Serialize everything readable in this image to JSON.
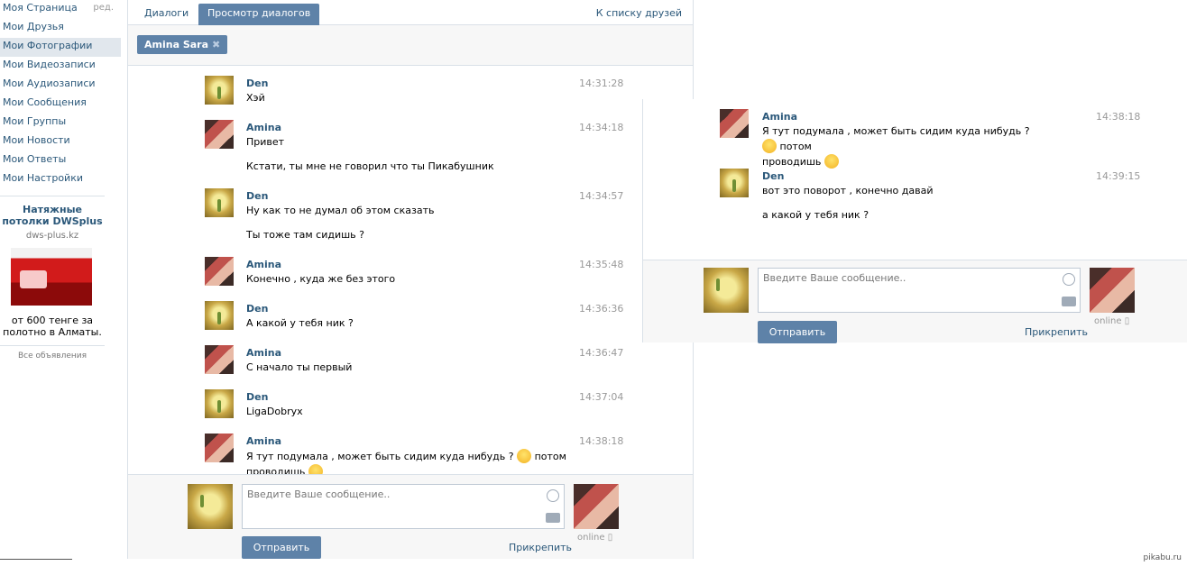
{
  "nav": {
    "items": [
      {
        "label": "Моя Страница"
      },
      {
        "label": "Мои Друзья"
      },
      {
        "label": "Мои Фотографии"
      },
      {
        "label": "Мои Видеозаписи"
      },
      {
        "label": "Мои Аудиозаписи"
      },
      {
        "label": "Мои Сообщения"
      },
      {
        "label": "Мои Группы"
      },
      {
        "label": "Мои Новости"
      },
      {
        "label": "Мои Ответы"
      },
      {
        "label": "Мои Настройки"
      }
    ],
    "edit": "ред.",
    "active_index": 2
  },
  "ad": {
    "title": "Натяжные потолки DWSplus",
    "domain": "dws-plus.kz",
    "text": "от 600 тенге за полотно в Алматы.",
    "all": "Все объявления"
  },
  "tabs": {
    "dialogs": "Диалоги",
    "view": "Просмотр диалогов",
    "to_friends": "К списку друзей"
  },
  "peer_chip": {
    "name": "Amina Sara",
    "close_icon": "close-icon"
  },
  "messages": [
    {
      "author": "Den",
      "time": "14:31:28",
      "lines": [
        "Хэй"
      ]
    },
    {
      "author": "Amina",
      "time": "14:34:18",
      "lines": [
        "Привет",
        "Кстати, ты мне не говорил что ты Пикабушник"
      ]
    },
    {
      "author": "Den",
      "time": "14:34:57",
      "lines": [
        "Ну как то не думал об этом сказать",
        "Ты тоже там сидишь ?"
      ]
    },
    {
      "author": "Amina",
      "time": "14:35:48",
      "lines": [
        "Конечно , куда же без этого"
      ]
    },
    {
      "author": "Den",
      "time": "14:36:36",
      "lines": [
        "А какой у тебя ник ?"
      ]
    },
    {
      "author": "Amina",
      "time": "14:36:47",
      "lines": [
        "С начало ты первый"
      ]
    },
    {
      "author": "Den",
      "time": "14:37:04",
      "lines": [
        "LigaDobryx"
      ]
    },
    {
      "author": "Amina",
      "time": "14:38:18",
      "text_a": "Я тут подумала , может быть сидим куда нибудь ?",
      "text_b": "потом",
      "text_c": "проводишь"
    }
  ],
  "crop_messages": [
    {
      "author": "Amina",
      "time": "14:38:18",
      "text_a": "Я тут подумала , может быть сидим куда нибудь ?",
      "text_b": "потом",
      "text_c": "проводишь"
    },
    {
      "author": "Den",
      "time": "14:39:15",
      "lines": [
        "вот это поворот , конечно давай",
        "а какой у тебя ник ?"
      ]
    }
  ],
  "composer": {
    "placeholder": "Введите Ваше сообщение..",
    "send": "Отправить",
    "attach": "Прикрепить",
    "online": "online"
  },
  "watermark": "pikabu.ru"
}
